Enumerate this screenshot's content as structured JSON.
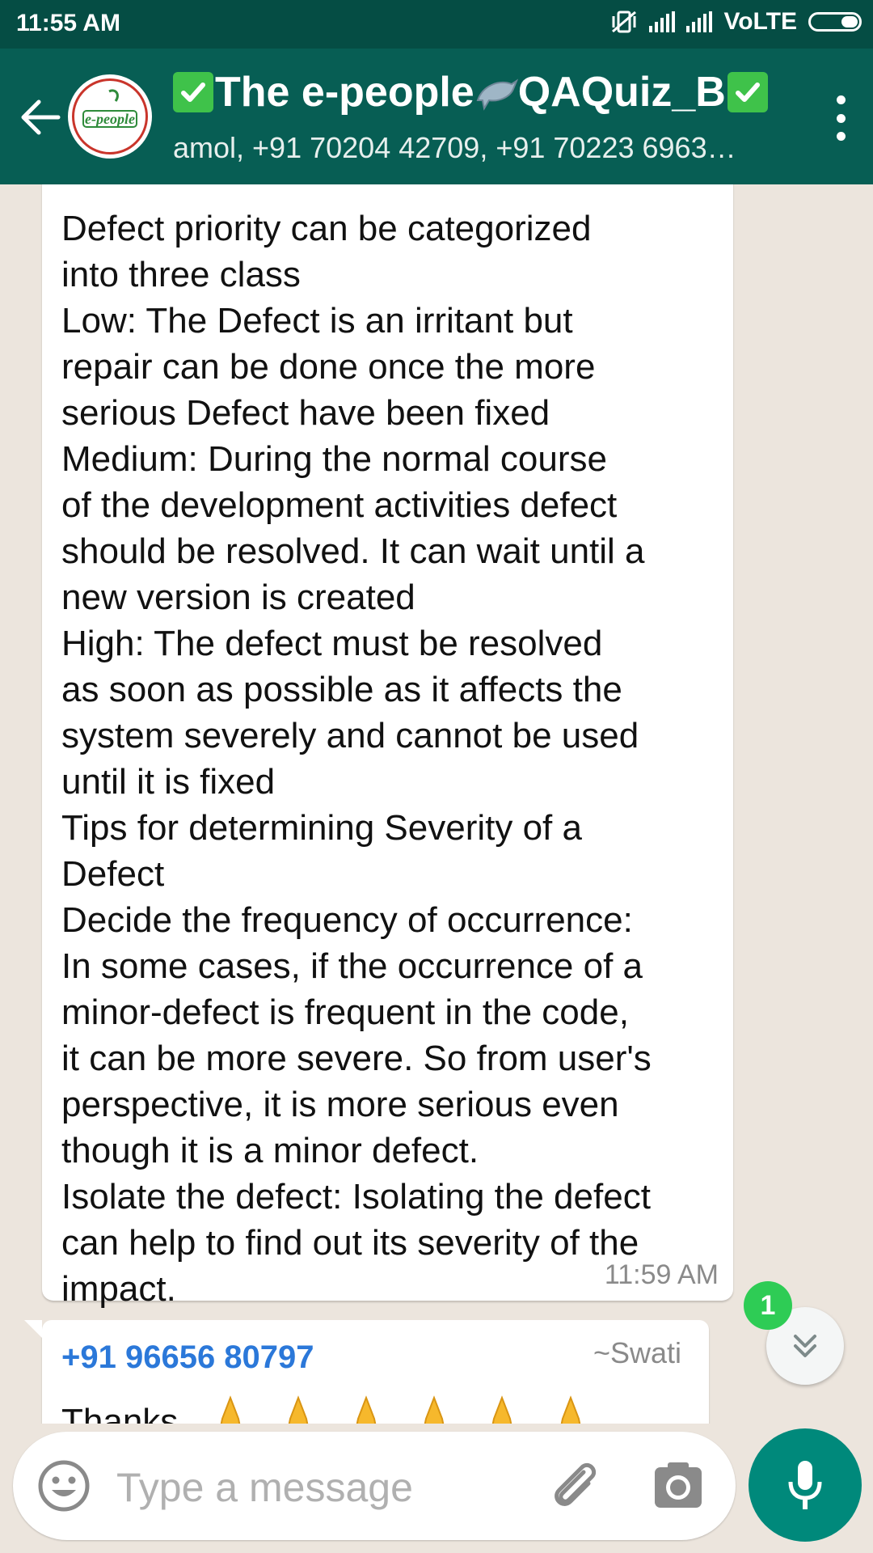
{
  "status_bar": {
    "time": "11:55 AM",
    "network": "VoLTE"
  },
  "header": {
    "group_name": "The e-people",
    "group_name_suffix": "QAQuiz_B",
    "participants": "amol, +91 70204 42709, +91 70223 6963…",
    "avatar_icon": "e-people-logo",
    "colors": {
      "bar": "#075e54",
      "status": "#054d44"
    }
  },
  "messages": [
    {
      "text": "Defect priority can be categorized\ninto three class\nLow: The Defect is an irritant but\nrepair can be done once the more\nserious Defect have been fixed\nMedium: During the normal course\nof the development activities defect\nshould be resolved. It can wait until a\nnew version is created\nHigh: The defect must be resolved\nas soon as possible as it affects the\nsystem severely and cannot be used\nuntil it is fixed\nTips for determining Severity of a\nDefect\nDecide the frequency of occurrence:\nIn some cases, if the occurrence of a\nminor-defect is frequent in the code,\nit can be more severe. So from user's\nperspective, it is more serious even\nthough it is a minor defect.\nIsolate the defect: Isolating the defect\ncan help to find out its severity of the\nimpact.",
      "time": "11:59 AM"
    },
    {
      "sender": "+91 96656 80797",
      "push_name": "~Swati",
      "text": "Thanks",
      "emoji_icon": "folded-hands-icon"
    }
  ],
  "unread_badge": "1",
  "composer": {
    "placeholder": "Type a message"
  }
}
